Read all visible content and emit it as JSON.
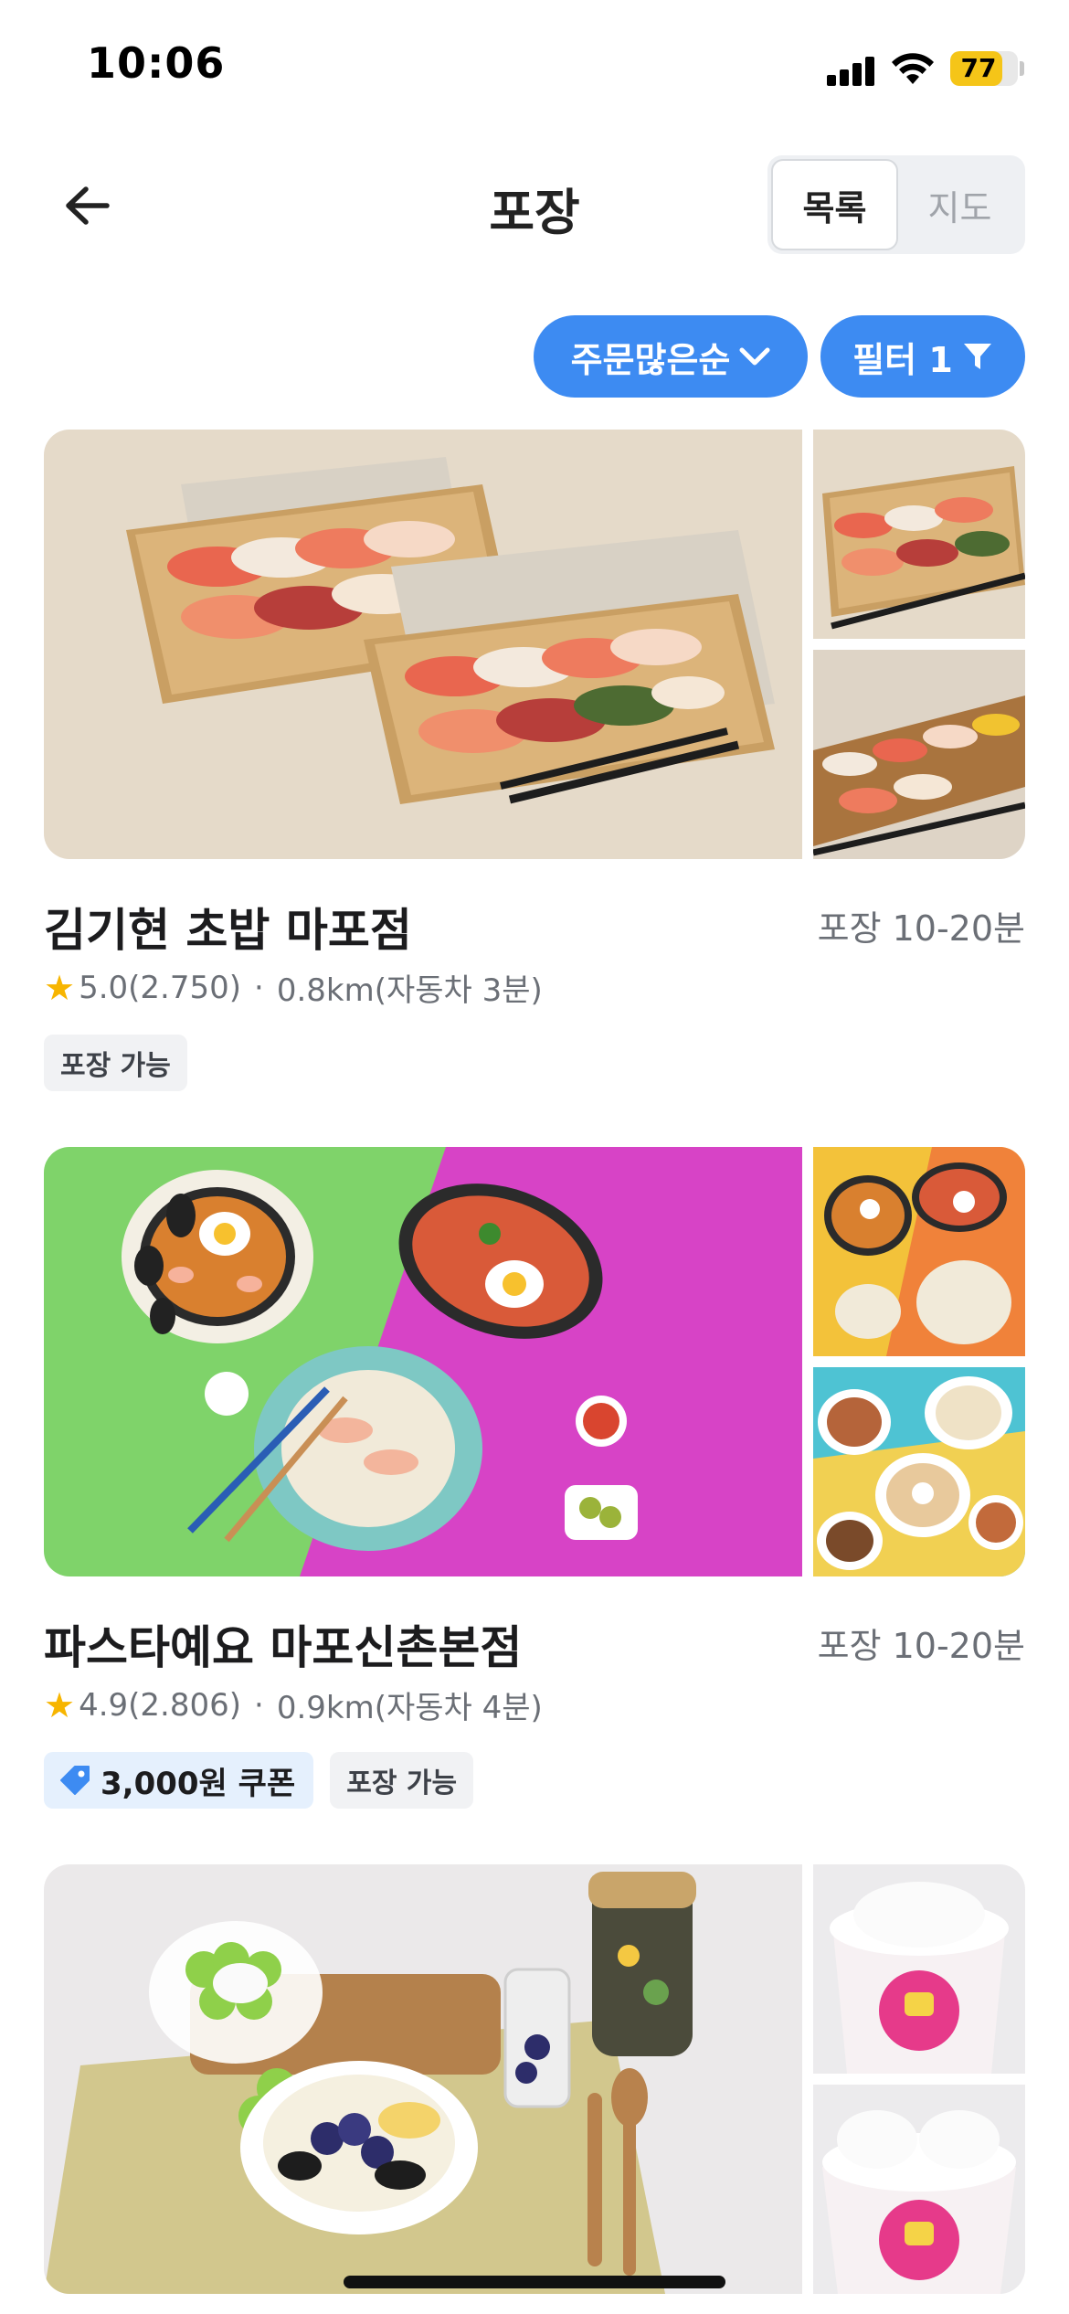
{
  "status_bar": {
    "time": "10:06",
    "battery": "77",
    "battery_level": 0.77
  },
  "header": {
    "title": "포장",
    "view_options": [
      "목록",
      "지도"
    ],
    "active_view": "목록"
  },
  "filters": {
    "sort_label": "주문많은순",
    "filter_label": "필터 1"
  },
  "stores": [
    {
      "name": "김기현 초밥 마포점",
      "pickup_time": "포장 10-20분",
      "rating": "5.0(2.750)",
      "distance": "0.8km(자동차 3분)",
      "coupon": null,
      "tags": [
        "포장 가능"
      ]
    },
    {
      "name": "파스타예요 마포신촌본점",
      "pickup_time": "포장 10-20분",
      "rating": "4.9(2.806)",
      "distance": "0.9km(자동차 4분)",
      "coupon": "3,000원 쿠폰",
      "tags": [
        "포장 가능"
      ]
    }
  ],
  "colors": {
    "accent": "#3d8bf2",
    "star": "#f7b500",
    "battery": "#f5c518"
  }
}
